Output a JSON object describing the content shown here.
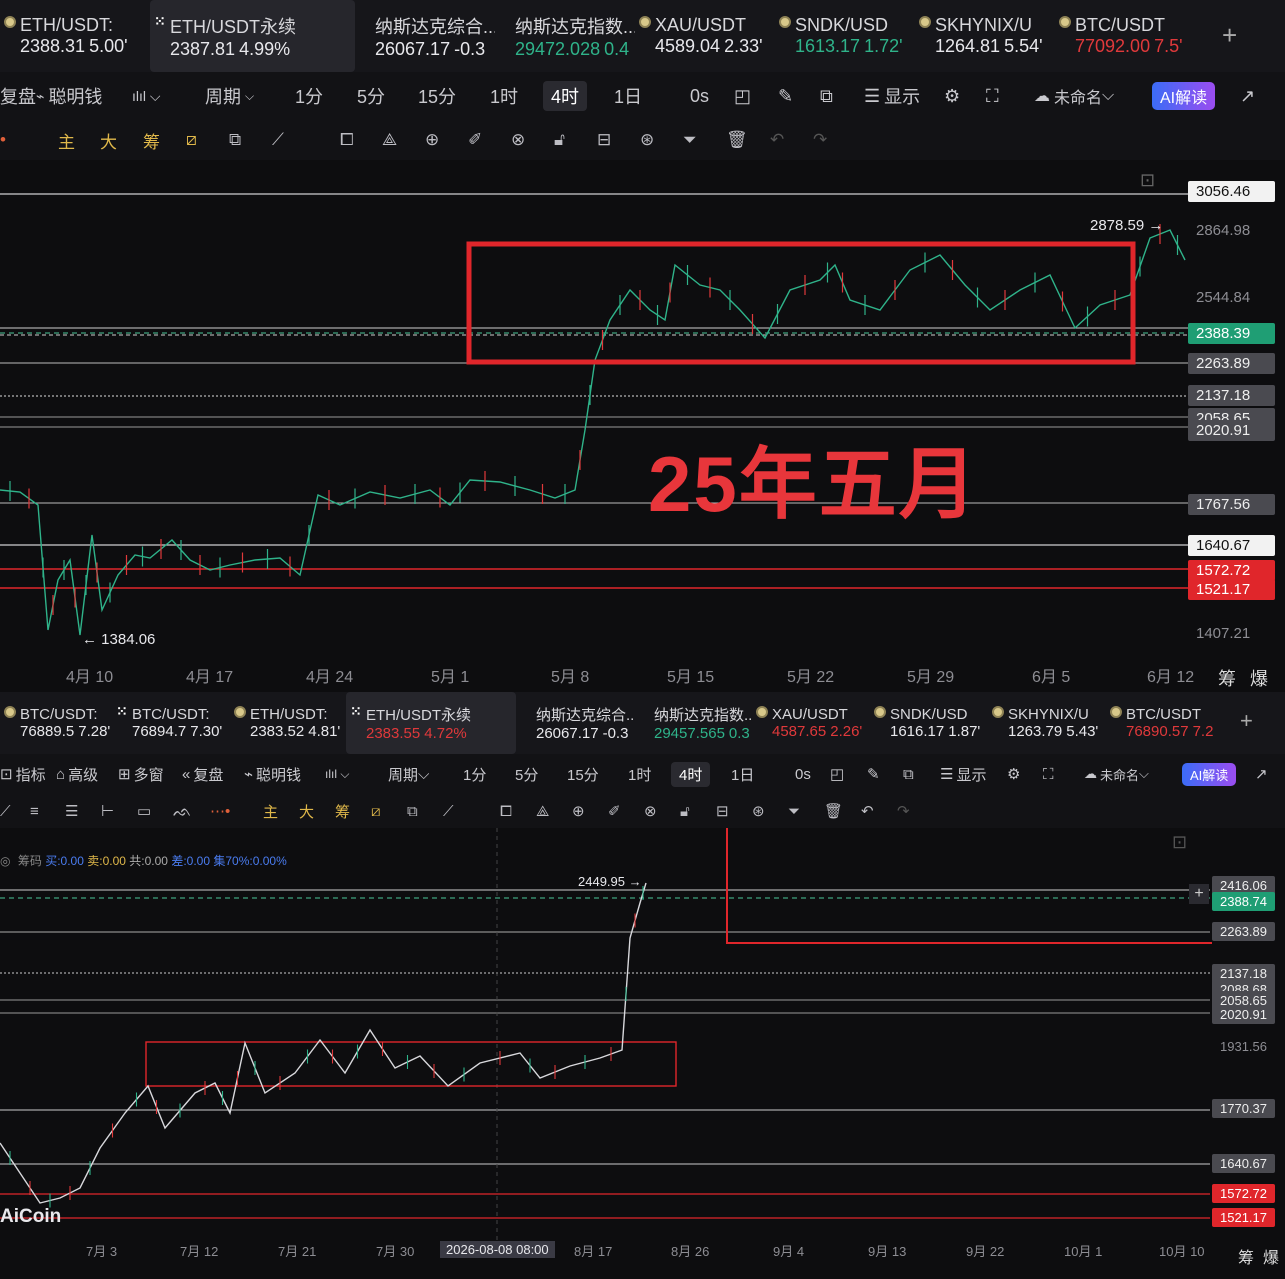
{
  "top": {
    "tickers": [
      {
        "name": "ETH/USDT:",
        "price": "2388.31",
        "chg": "5.00'",
        "icon": "coin-dot-icon",
        "cls": "up"
      },
      {
        "name": "ETH/USDT永续",
        "price": "2387.81",
        "chg": "4.99%",
        "icon": "perp-icon",
        "cls": "up",
        "active": true
      },
      {
        "name": "纳斯达克综合...",
        "price": "26067.17",
        "chg": "-0.3",
        "icon": "",
        "cls": "up"
      },
      {
        "name": "纳斯达克指数...",
        "price": "29472.028",
        "chg": "0.4",
        "icon": "",
        "cls": "dn"
      },
      {
        "name": "XAU/USDT",
        "price": "4589.04",
        "chg": "2.33'",
        "icon": "coin-dot-icon",
        "cls": "up"
      },
      {
        "name": "SNDK/USD",
        "price": "1613.17",
        "chg": "1.72'",
        "icon": "coin-dot-icon",
        "cls": "dn"
      },
      {
        "name": "SKHYNIX/U",
        "price": "1264.81",
        "chg": "5.54'",
        "icon": "coin-dot-icon",
        "cls": "up"
      },
      {
        "name": "BTC/USDT",
        "price": "77092.00",
        "chg": "7.5'",
        "icon": "coin-dot-icon",
        "cls": "rd"
      }
    ],
    "toolbar": {
      "left": [
        "复盘",
        "聪明钱"
      ],
      "period": "周期",
      "intervals": [
        "1分",
        "5分",
        "15分",
        "1时",
        "4时",
        "1日"
      ],
      "selected": "4时",
      "zero": "0s",
      "display": "显示",
      "unnamed": "未命名",
      "ai": "AI解读"
    },
    "draw_tools": {
      "zhu": "主",
      "da": "大",
      "chou": "筹"
    },
    "price_labels": [
      {
        "v": "3056.46",
        "style": "white"
      },
      {
        "v": "2864.98",
        "style": "plain"
      },
      {
        "v": "2544.84",
        "style": "plain"
      },
      {
        "v": "2388.39",
        "style": "green"
      },
      {
        "v": "2263.89",
        "style": "gray"
      },
      {
        "v": "2137.18",
        "style": "gray"
      },
      {
        "v": "2058.65",
        "style": "gray"
      },
      {
        "v": "2020.91",
        "style": "gray"
      },
      {
        "v": "1767.56",
        "style": "gray"
      },
      {
        "v": "1640.67",
        "style": "white"
      },
      {
        "v": "1572.72",
        "style": "red"
      },
      {
        "v": "1521.17",
        "style": "red"
      },
      {
        "v": "1407.21",
        "style": "plain"
      }
    ],
    "high_label": "2878.59 →",
    "low_label": "← 1384.06",
    "annotation": "25年五月",
    "dates": [
      "4月 10",
      "4月 17",
      "4月 24",
      "5月 1",
      "5月 8",
      "5月 15",
      "5月 22",
      "5月 29",
      "6月 5",
      "6月 12"
    ],
    "corner": [
      "筹",
      "爆"
    ]
  },
  "bottom": {
    "tickers": [
      {
        "name": "BTC/USDT:",
        "price": "76889.5",
        "chg": "7.28'",
        "icon": "coin-dot-icon",
        "cls": "up"
      },
      {
        "name": "BTC/USDT:",
        "price": "76894.7",
        "chg": "7.30'",
        "icon": "perp-icon",
        "cls": "up"
      },
      {
        "name": "ETH/USDT:",
        "price": "2383.52",
        "chg": "4.81'",
        "icon": "coin-dot-icon",
        "cls": "up"
      },
      {
        "name": "ETH/USDT永续",
        "price": "2383.55",
        "chg": "4.72%",
        "icon": "perp-icon",
        "cls": "rd",
        "active": true
      },
      {
        "name": "纳斯达克综合...",
        "price": "26067.17",
        "chg": "-0.3",
        "icon": "",
        "cls": "up"
      },
      {
        "name": "纳斯达克指数...",
        "price": "29457.565",
        "chg": "0.3",
        "icon": "",
        "cls": "dn"
      },
      {
        "name": "XAU/USDT",
        "price": "4587.65",
        "chg": "2.26'",
        "icon": "coin-dot-icon",
        "cls": "rd"
      },
      {
        "name": "SNDK/USD",
        "price": "1616.17",
        "chg": "1.87'",
        "icon": "coin-dot-icon",
        "cls": "up"
      },
      {
        "name": "SKHYNIX/U",
        "price": "1263.79",
        "chg": "5.43'",
        "icon": "coin-dot-icon",
        "cls": "up"
      },
      {
        "name": "BTC/USDT",
        "price": "76890.57",
        "chg": "7.2",
        "icon": "coin-dot-icon",
        "cls": "rd"
      }
    ],
    "toolbar": {
      "left": [
        "指标",
        "高级",
        "多窗",
        "复盘",
        "聪明钱"
      ],
      "period": "周期",
      "intervals": [
        "1分",
        "5分",
        "15分",
        "1时",
        "4时",
        "1日"
      ],
      "selected": "4时",
      "zero": "0s",
      "display": "显示",
      "unnamed": "未命名",
      "ai": "AI解读"
    },
    "chip_info": {
      "label": "筹码",
      "buy": "买:0.00",
      "sell": "卖:0.00",
      "total": "共:0.00",
      "diff": "差:0.00",
      "conc": "集70%:0.00%"
    },
    "high_label": "2449.95 →",
    "price_labels": [
      {
        "v": "2416.06",
        "style": "gray"
      },
      {
        "v": "2388.74",
        "style": "green"
      },
      {
        "v": "2263.89",
        "style": "gray"
      },
      {
        "v": "2137.18",
        "style": "gray"
      },
      {
        "v": "2088.68",
        "style": "gray"
      },
      {
        "v": "2058.65",
        "style": "gray"
      },
      {
        "v": "2020.91",
        "style": "gray"
      },
      {
        "v": "1931.56",
        "style": "plain"
      },
      {
        "v": "1770.37",
        "style": "gray"
      },
      {
        "v": "1640.67",
        "style": "gray"
      },
      {
        "v": "1572.72",
        "style": "red"
      },
      {
        "v": "1521.17",
        "style": "red"
      }
    ],
    "dates": [
      "7月 3",
      "7月 12",
      "7月 21",
      "7月 30",
      "2026-08-08 08:00",
      "8月 17",
      "8月 26",
      "9月 4",
      "9月 13",
      "9月 22",
      "10月 1",
      "10月 10"
    ],
    "watermark": "AiCoin",
    "corner": [
      "筹",
      "爆"
    ]
  }
}
